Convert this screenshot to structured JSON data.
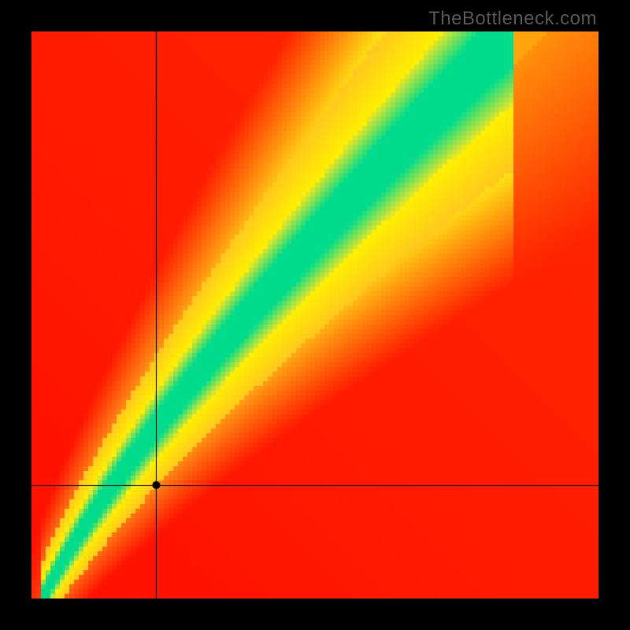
{
  "watermark": "TheBottleneck.com",
  "chart_data": {
    "type": "heatmap",
    "title": "",
    "xlabel": "",
    "ylabel": "",
    "xlim": [
      0,
      1
    ],
    "ylim": [
      0,
      1
    ],
    "grid": false,
    "legend": false,
    "colorscale_description": "red (low) → orange → yellow → green (optimal ridge)",
    "ridge_description": "optimal diagonal band from bottom-left to top-right, slightly steeper than 45°, widening toward top",
    "crosshair_point": {
      "x": 0.22,
      "y": 0.2
    },
    "pixelation": 120
  }
}
